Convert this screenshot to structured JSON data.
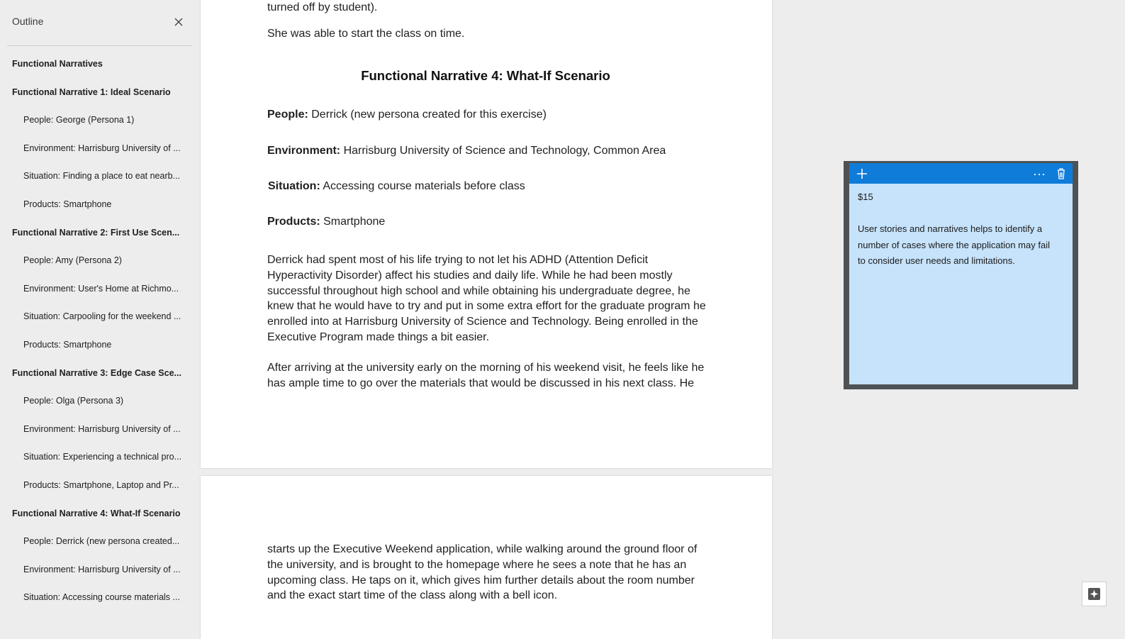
{
  "outline": {
    "title": "Outline",
    "close_icon": "close-icon",
    "items": [
      {
        "level": 1,
        "label": "Functional Narratives"
      },
      {
        "level": 1,
        "label": "Functional Narrative 1: Ideal Scenario"
      },
      {
        "level": 2,
        "label": "People: George (Persona 1)"
      },
      {
        "level": 2,
        "label": "Environment: Harrisburg University of ..."
      },
      {
        "level": 2,
        "label": "Situation: Finding a place to eat nearb..."
      },
      {
        "level": 2,
        "label": "Products: Smartphone"
      },
      {
        "level": 1,
        "label": "Functional Narrative 2: First Use Scen..."
      },
      {
        "level": 2,
        "label": "People: Amy (Persona 2)"
      },
      {
        "level": 2,
        "label": "Environment: User's Home at Richmo..."
      },
      {
        "level": 2,
        "label": "Situation: Carpooling for the weekend ..."
      },
      {
        "level": 2,
        "label": "Products: Smartphone"
      },
      {
        "level": 1,
        "label": "Functional Narrative 3: Edge Case Sce..."
      },
      {
        "level": 2,
        "label": "People: Olga (Persona 3)"
      },
      {
        "level": 2,
        "label": "Environment: Harrisburg University of ..."
      },
      {
        "level": 2,
        "label": "Situation: Experiencing a technical pro..."
      },
      {
        "level": 2,
        "label": "Products: Smartphone, Laptop and Pr..."
      },
      {
        "level": 1,
        "label": "Functional Narrative 4: What-If Scenario"
      },
      {
        "level": 2,
        "label": "People: Derrick (new persona created..."
      },
      {
        "level": 2,
        "label": "Environment: Harrisburg University of ..."
      },
      {
        "level": 2,
        "label": "Situation: Accessing course materials ..."
      }
    ]
  },
  "document": {
    "page1": {
      "line_top": "turned off by student).",
      "line_start": "She was able to start the class on time.",
      "heading": "Functional Narrative 4: What-If Scenario",
      "people_label": "People:",
      "people_value": " Derrick (new persona created for this exercise)",
      "environment_label": "Environment:",
      "environment_value": " Harrisburg University of Science and Technology, Common Area",
      "situation_label": "Situation:",
      "situation_value": " Accessing course materials before class",
      "products_label": "Products:",
      "products_value": " Smartphone",
      "para1_lines": [
        "Derrick had spent most of his life trying to not let his ADHD (Attention Deficit",
        "Hyperactivity Disorder) affect his studies and daily life. While he had been mostly",
        "successful throughout high school and while obtaining his undergraduate degree, he",
        "knew that he would have to try and put in some extra effort for the graduate program he",
        "enrolled into at Harrisburg University of Science and Technology. Being enrolled in the",
        "Executive Program made things a bit easier."
      ],
      "para2_lines": [
        "After arriving at the university early on the morning of his weekend visit, he feels like he",
        "has ample time to go over the materials that would be discussed in his next class. He"
      ]
    },
    "page2": {
      "para_lines": [
        "starts up the Executive Weekend application, while walking around the ground floor of",
        "the university, and is brought to the homepage where he sees a note that he has an",
        "upcoming class. He taps on it, which gives him further details about the room number",
        "and the exact start time of the class along with a bell icon."
      ]
    }
  },
  "sticky_note": {
    "add_icon": "plus-icon",
    "menu_icon": "more-icon",
    "delete_icon": "trash-icon",
    "price": "$15",
    "body_lines": [
      "User stories and narratives helps to identify a",
      "number of cases where the application may fail",
      "to consider user needs and limitations."
    ],
    "bar_color": "#0f7cd9",
    "body_color": "#c6e3fb"
  },
  "corner_button": {
    "icon": "sparkle-note-icon"
  }
}
